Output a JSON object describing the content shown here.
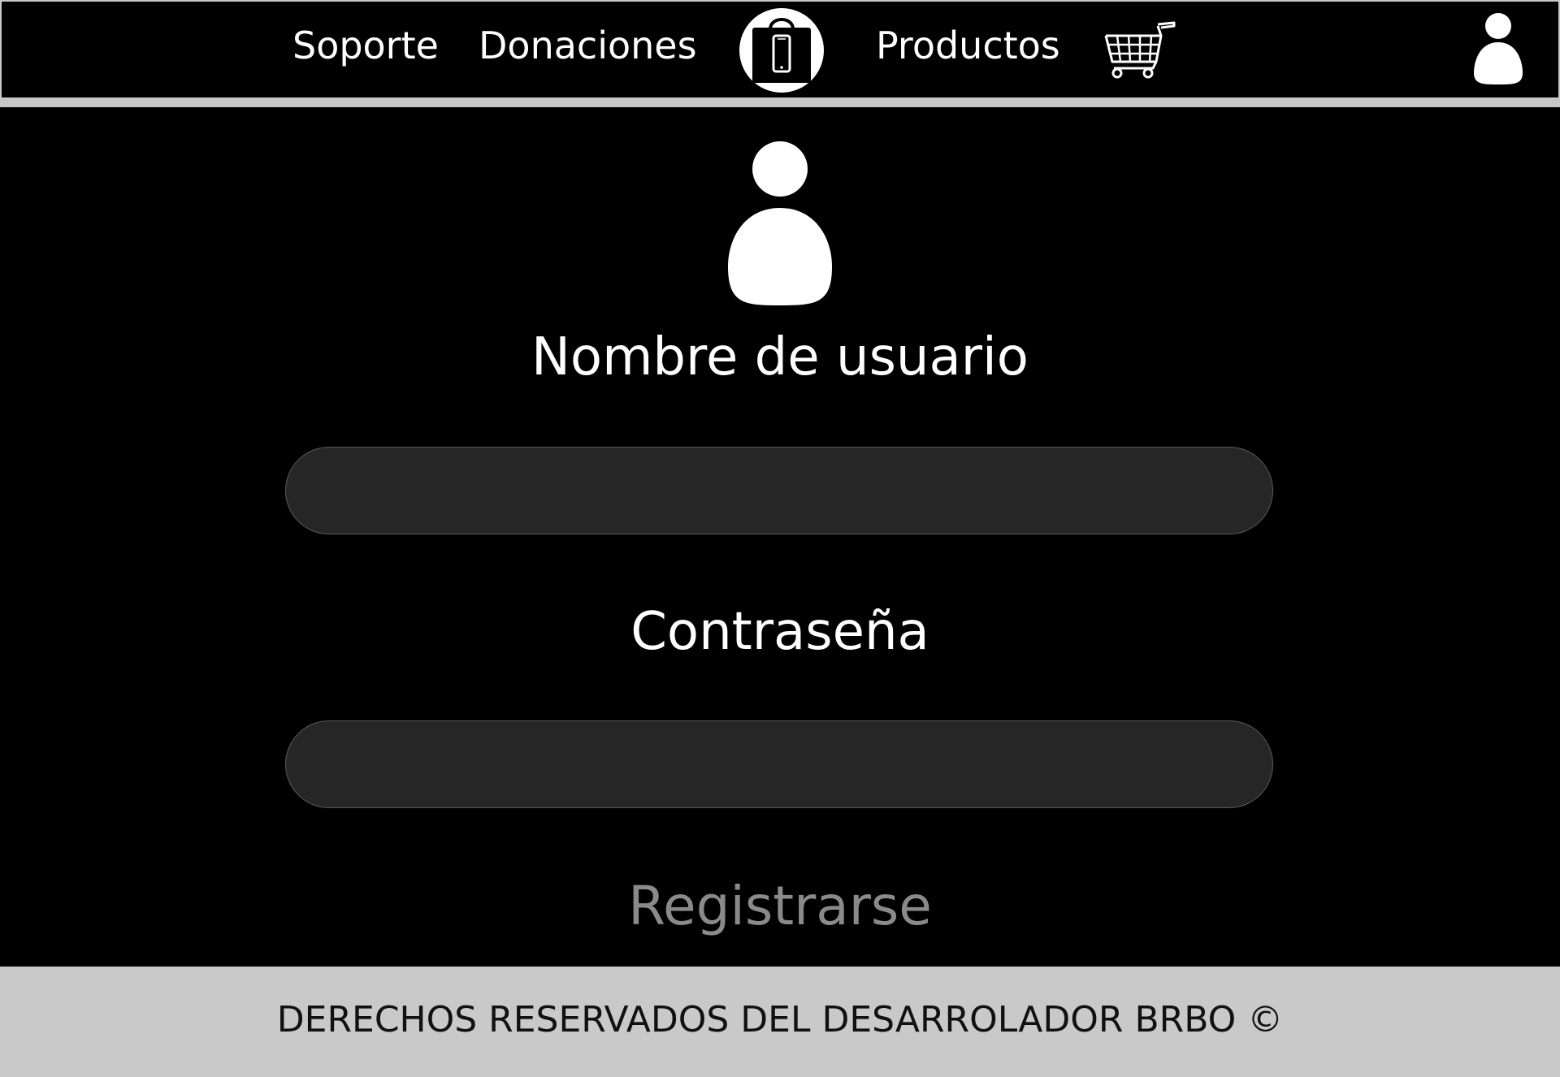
{
  "nav": {
    "soporte": "Soporte",
    "donaciones": "Donaciones",
    "productos": "Productos",
    "logo_icon": "shopping-bag-phone-icon",
    "cart_icon": "shopping-cart-icon",
    "account_icon": "user-icon"
  },
  "login": {
    "avatar_icon": "user-icon",
    "username_label": "Nombre de usuario",
    "username_value": "",
    "password_label": "Contraseña",
    "password_value": "",
    "register_link": "Registrarse"
  },
  "footer": {
    "text": "DERECHOS RESERVADOS DEL DESARROLADOR BRBO ©"
  },
  "colors": {
    "background": "#000000",
    "text": "#ffffff",
    "input_fill": "#262626",
    "muted_link": "#8a8a8a",
    "footer_bg": "#c9c9c9"
  }
}
